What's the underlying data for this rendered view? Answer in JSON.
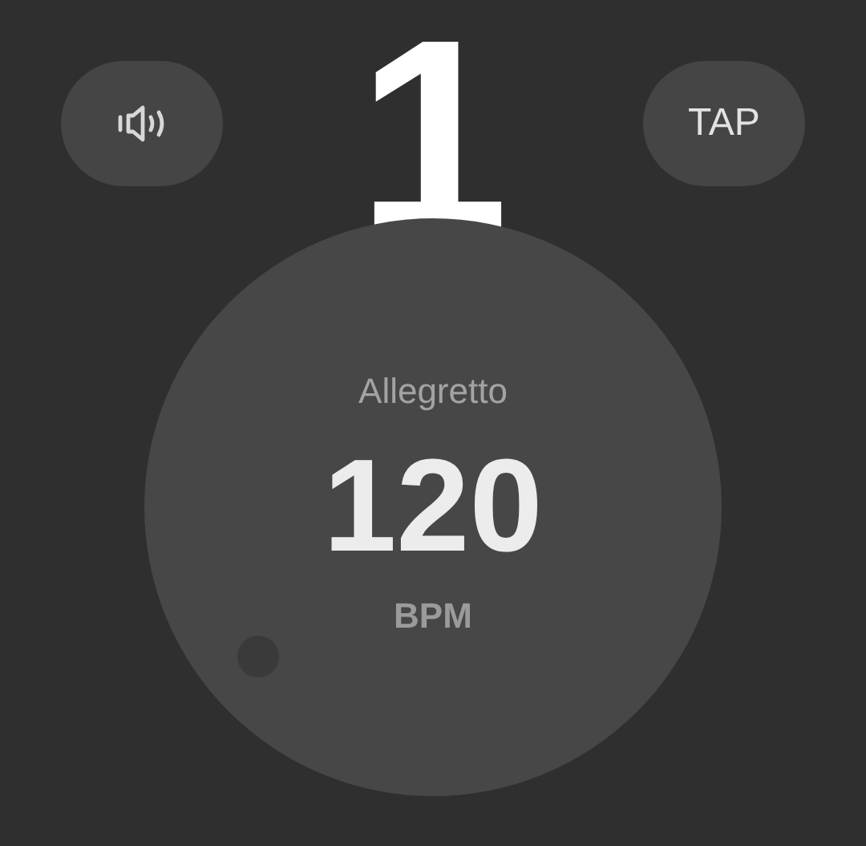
{
  "beat": "1",
  "buttons": [
    {
      "kind": "sound"
    },
    {
      "kind": "tap",
      "label": "TAP"
    }
  ],
  "tempo": {
    "marking": "Allegretto",
    "bpm": "120",
    "unit": "BPM"
  }
}
